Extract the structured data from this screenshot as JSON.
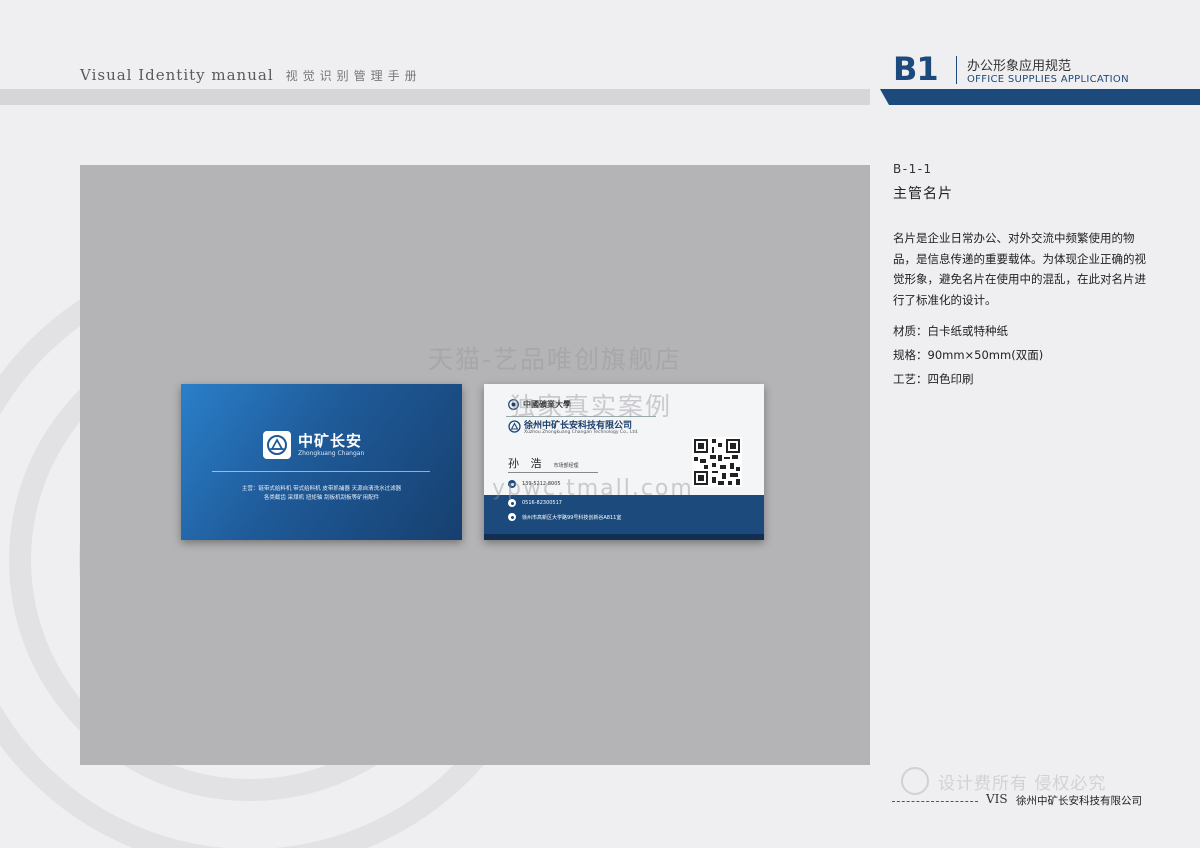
{
  "header": {
    "title_en": "Visual Identity  manual",
    "title_cn": "视觉识别管理手册",
    "section_code": "B1",
    "section_cn": "办公形象应用规范",
    "section_en": "OFFICE SUPPLIES APPLICATION"
  },
  "card_front": {
    "company_name": "中矿长安",
    "company_pinyin": "Zhongkuang Changan",
    "business_line1": "主营：链带式给料机  带式给料机  皮带抓捕器  天源自清洗水过滤器",
    "business_line2": "各类截齿  采煤机  扭矩轴  刮板机刮板等矿用配件"
  },
  "card_back": {
    "university": "中國礦業大學",
    "company": "徐州中矿长安科技有限公司",
    "company_en": "Xuzhou Zhongkuang Changan Technology Co., Ltd.",
    "person_name": "孙 浩",
    "person_title": "市场部经理",
    "phone": "139-5212-8005",
    "tel": "0516-82300517",
    "address": "徐州市高新区大学路99号科技创新谷A811室"
  },
  "watermarks": {
    "line1": "天猫-艺品唯创旗舰店",
    "line2": "独家真实案例",
    "line3": "ypwc.tmall.com",
    "footer_mark": "设计费所有 侵权必究"
  },
  "content": {
    "code": "B-1-1",
    "title": "主管名片",
    "description": "名片是企业日常办公、对外交流中频繁使用的物品，是信息传递的重要载体。为体现企业正确的视觉形象，避免名片在使用中的混乱，在此对名片进行了标准化的设计。",
    "material": "材质：白卡纸或特种纸",
    "size": "规格：90mm×50mm(双面)",
    "process": "工艺：四色印刷"
  },
  "footer": {
    "vis": "VIS",
    "company": "徐州中矿长安科技有限公司"
  },
  "colors": {
    "brand_blue": "#1c4a7c",
    "panel_grey": "#b4b4b6",
    "page_bg": "#efeff1"
  }
}
